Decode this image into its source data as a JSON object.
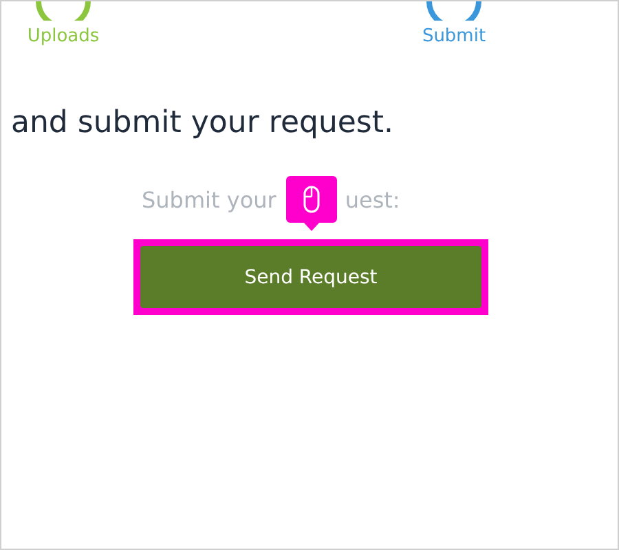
{
  "steps": [
    {
      "label": "Uploads",
      "color": "#8cc63f"
    },
    {
      "label": "Submit",
      "color": "#3a97dc"
    }
  ],
  "heading": "and submit your request.",
  "prompt": {
    "before": "Submit your",
    "after": "uest:"
  },
  "button": {
    "label": "Send Request",
    "highlighted": true
  }
}
